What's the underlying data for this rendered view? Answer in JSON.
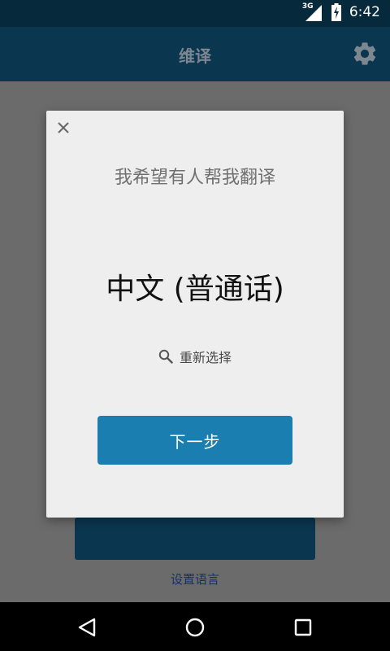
{
  "status_bar": {
    "network_label": "3G",
    "time": "6:42",
    "icons": [
      "signal-icon",
      "battery-charging-icon"
    ]
  },
  "app_bar": {
    "title": "维译",
    "settings_icon": "gear-icon"
  },
  "dialog": {
    "close_icon": "close-icon",
    "prompt": "我希望有人帮我翻译",
    "language": "中文 (普通话)",
    "reselect_label": "重新选择",
    "reselect_icon": "search-icon",
    "next_label": "下一步"
  },
  "background": {
    "set_language_link": "设置语言"
  },
  "nav_bar": {
    "icons": [
      "back-icon",
      "home-icon",
      "recents-icon"
    ]
  },
  "colors": {
    "status_bar": "#062a3c",
    "app_bar": "#0b3650",
    "accent": "#1a7eb0",
    "dialog_bg": "#eeeeee",
    "scrim": "#6b6b6b",
    "link": "#152f76"
  }
}
